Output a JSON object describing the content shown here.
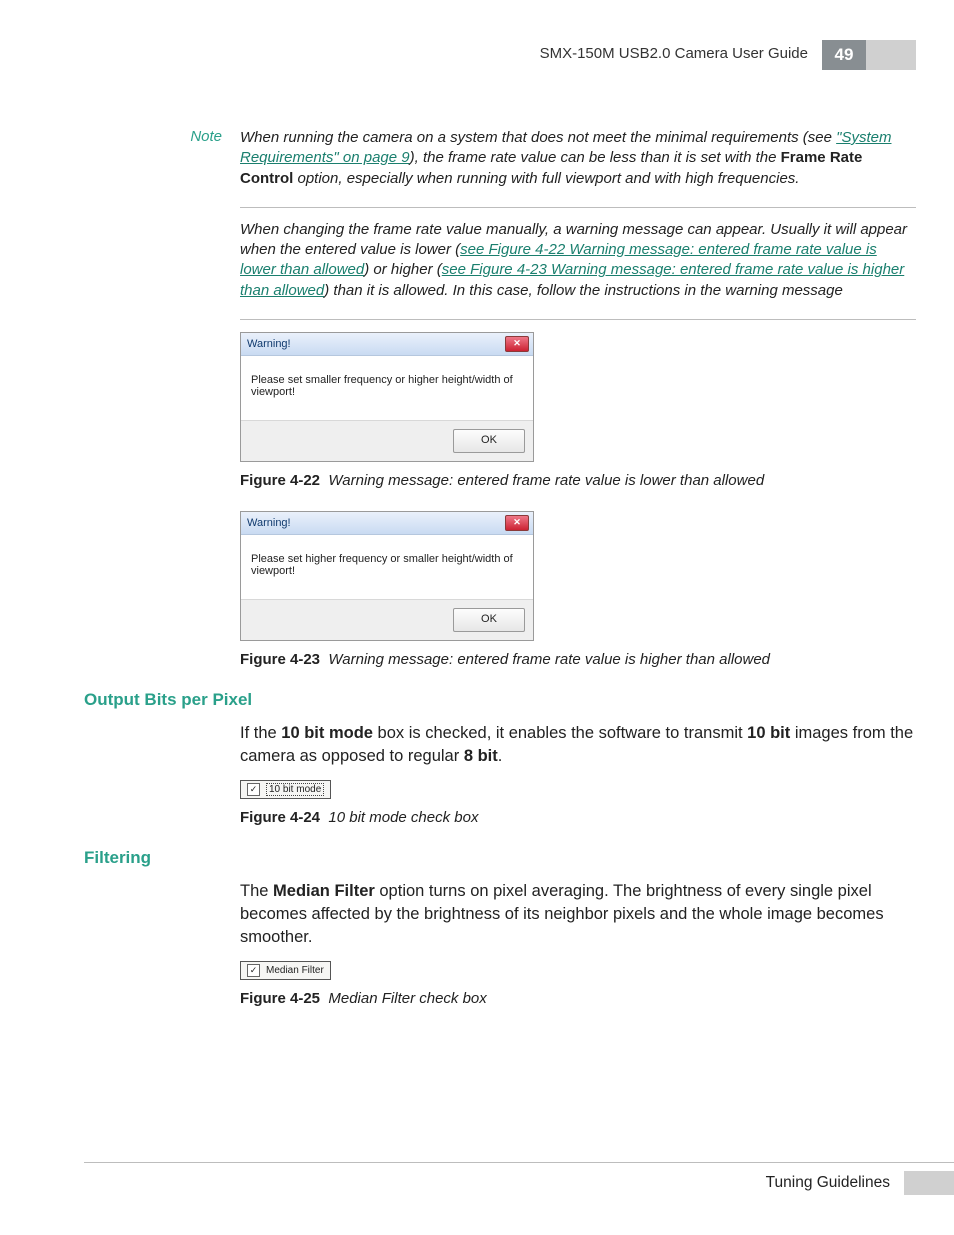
{
  "header": {
    "title": "SMX-150M USB2.0 Camera User Guide",
    "page_number": "49"
  },
  "note1": {
    "label": "Note",
    "pre": "When running the camera on a system that does not meet the minimal requirements (see ",
    "link": "\"System Requirements\" on page 9",
    "mid": "), the frame rate value can be less than it is set with the ",
    "bold": "Frame Rate Control",
    "post": " option, especially when running with full viewport and with high frequencies."
  },
  "note2": {
    "pre": "When changing the frame rate value manually, a warning message can appear. Usually it will appear when the entered value is lower (",
    "link1": "see Figure 4-22 Warning message: entered frame rate value is lower than allowed",
    "mid1": ") or higher (",
    "link2": "see Figure 4-23 Warning message: entered frame rate value is higher than allowed",
    "post": ") than it is allowed. In this case, follow the instructions in the warning message"
  },
  "dialog1": {
    "title": "Warning!",
    "message": "Please set smaller frequency or higher height/width of viewport!",
    "ok": "OK"
  },
  "fig22": {
    "num": "Figure 4-22",
    "text": "Warning message: entered frame rate value is lower than allowed"
  },
  "dialog2": {
    "title": "Warning!",
    "message": "Please set higher frequency or smaller height/width of viewport!",
    "ok": "OK"
  },
  "fig23": {
    "num": "Figure 4-23",
    "text": "Warning message: entered frame rate value is higher than allowed"
  },
  "section_output": {
    "heading": "Output Bits per Pixel",
    "para_pre": "If the ",
    "b1": "10 bit mode",
    "para_mid1": " box is checked, it enables the software to transmit ",
    "b2": "10 bit",
    "para_mid2": " images from the camera as opposed to regular ",
    "b3": "8 bit",
    "para_post": "."
  },
  "check1": {
    "label": "10 bit mode"
  },
  "fig24": {
    "num": "Figure 4-24",
    "text": "10 bit mode check box"
  },
  "section_filtering": {
    "heading": "Filtering",
    "para_pre": "The ",
    "b1": "Median Filter",
    "para_post": " option turns on pixel averaging. The brightness of every single pixel becomes affected by the brightness of its neighbor pixels and the whole image becomes smoother."
  },
  "check2": {
    "label": "Median Filter"
  },
  "fig25": {
    "num": "Figure 4-25",
    "text": "Median Filter check box"
  },
  "footer": {
    "section": "Tuning Guidelines"
  }
}
